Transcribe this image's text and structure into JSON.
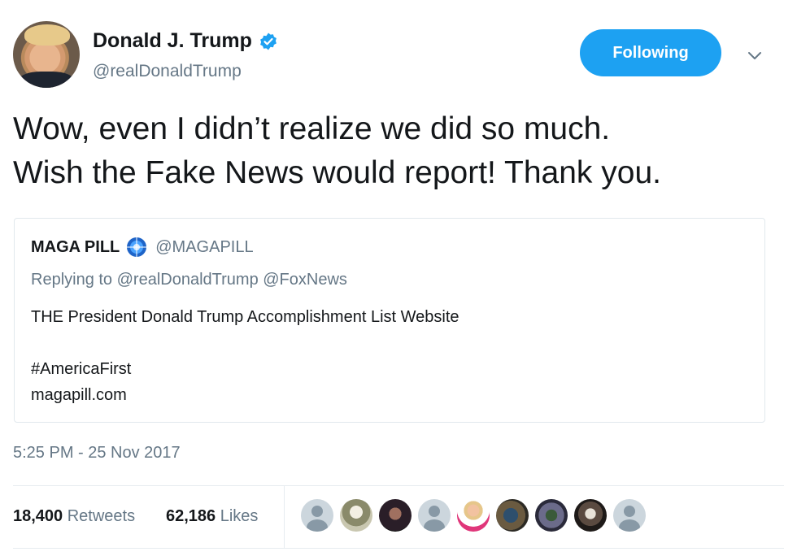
{
  "author": {
    "display_name": "Donald J. Trump",
    "handle": "@realDonaldTrump",
    "verified_icon": "verified-badge-icon",
    "follow_button_label": "Following"
  },
  "tweet": {
    "text_line1": "Wow, even I didn’t realize we did so much.",
    "text_line2": "Wish the Fake News would report! Thank you.",
    "timestamp": "5:25 PM - 25 Nov 2017"
  },
  "quoted_tweet": {
    "display_name": "MAGA PILL",
    "handle": "@MAGAPILL",
    "replying_to": "Replying to @realDonaldTrump @FoxNews",
    "line1": "THE President Donald Trump Accomplishment List Website",
    "line2": "#AmericaFirst",
    "line3": "magapill.com"
  },
  "stats": {
    "retweets_count": "18,400",
    "retweets_label": "Retweets",
    "likes_count": "62,186",
    "likes_label": "Likes"
  },
  "colors": {
    "accent": "#1da1f2",
    "secondary_text": "#657786",
    "primary_text": "#14171a"
  }
}
